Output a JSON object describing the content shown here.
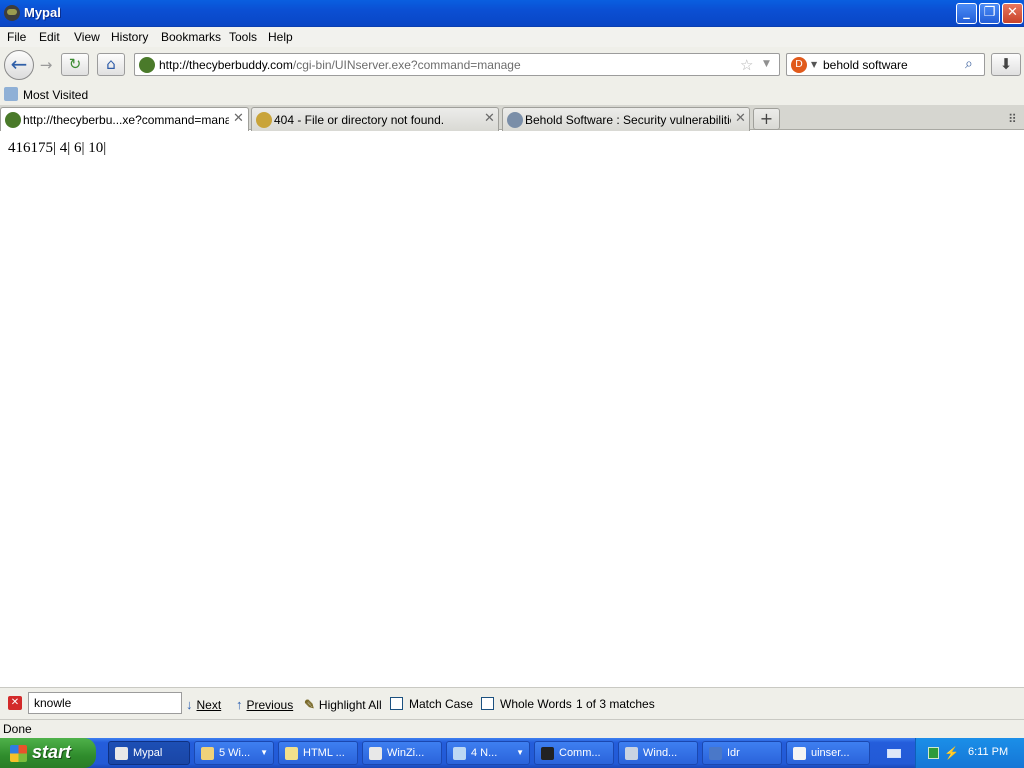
{
  "window": {
    "title": "Mypal",
    "controls": {
      "minimize": "_",
      "maximize": "❐",
      "close": "✕"
    }
  },
  "menu": [
    "File",
    "Edit",
    "View",
    "History",
    "Bookmarks",
    "Tools",
    "Help"
  ],
  "nav": {
    "url_host": "http://thecyberbuddy.com",
    "url_path": "/cgi-bin/UINserver.exe?command=manage",
    "search_query": "behold software"
  },
  "bookmarks": {
    "most_visited": "Most Visited"
  },
  "tabs": [
    {
      "title": "http://thecyberbu...xe?command=manage",
      "active": true
    },
    {
      "title": "404 - File or directory not found.",
      "active": false
    },
    {
      "title": "Behold Software : Security vulnerabilities",
      "active": false
    }
  ],
  "content": {
    "text": "416175| 4| 6| 10|"
  },
  "findbar": {
    "query": "knowle",
    "next": "Next",
    "previous": "Previous",
    "highlight_all": "Highlight All",
    "match_case": "Match Case",
    "whole_words": "Whole Words",
    "status": "1 of 3 matches"
  },
  "statusbar": {
    "text": "Done"
  },
  "taskbar": {
    "start": "start",
    "tasks": [
      {
        "label": "Mypal",
        "active": true
      },
      {
        "label": "5 Wi...",
        "active": false,
        "grouped": true
      },
      {
        "label": "HTML ...",
        "active": false
      },
      {
        "label": "WinZi...",
        "active": false
      },
      {
        "label": "4 N...",
        "active": false,
        "grouped": true
      },
      {
        "label": "Comm...",
        "active": false
      },
      {
        "label": "Wind...",
        "active": false
      },
      {
        "label": "Idr",
        "active": false
      },
      {
        "label": "uinser...",
        "active": false
      }
    ],
    "clock": "6:11 PM"
  }
}
